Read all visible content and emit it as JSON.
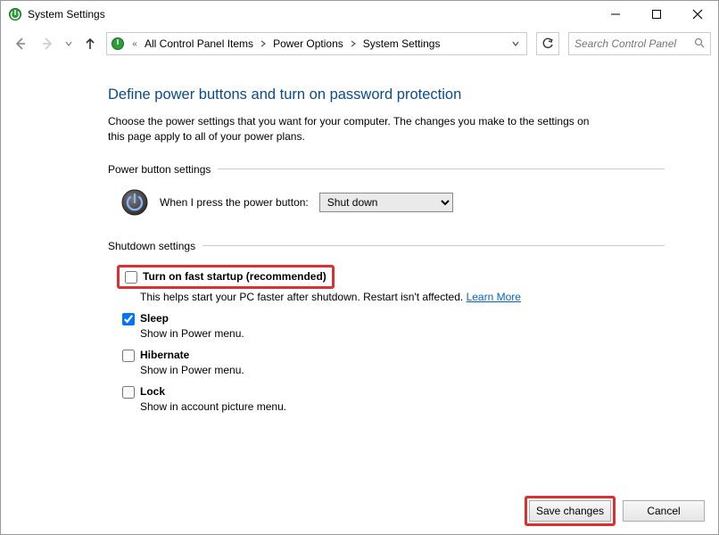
{
  "window": {
    "title": "System Settings"
  },
  "breadcrumb": {
    "prefix_marker": "«",
    "items": [
      "All Control Panel Items",
      "Power Options",
      "System Settings"
    ]
  },
  "search": {
    "placeholder": "Search Control Panel"
  },
  "page": {
    "heading": "Define power buttons and turn on password protection",
    "description": "Choose the power settings that you want for your computer. The changes you make to the settings on this page apply to all of your power plans."
  },
  "power_section": {
    "legend": "Power button settings",
    "label": "When I press the power button:",
    "selected": "Shut down"
  },
  "shutdown_section": {
    "legend": "Shutdown settings",
    "options": [
      {
        "label": "Turn on fast startup (recommended)",
        "checked": false,
        "desc": "This helps start your PC faster after shutdown. Restart isn't affected. ",
        "link": "Learn More",
        "highlight": true
      },
      {
        "label": "Sleep",
        "checked": true,
        "desc": "Show in Power menu."
      },
      {
        "label": "Hibernate",
        "checked": false,
        "desc": "Show in Power menu."
      },
      {
        "label": "Lock",
        "checked": false,
        "desc": "Show in account picture menu."
      }
    ]
  },
  "footer": {
    "save": "Save changes",
    "cancel": "Cancel"
  }
}
